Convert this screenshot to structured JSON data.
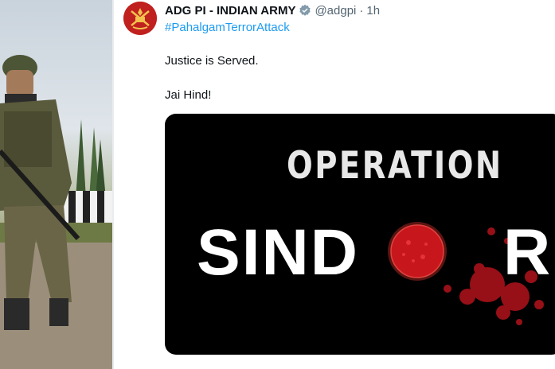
{
  "tweet": {
    "account_name": "ADG PI - INDIAN ARMY",
    "handle": "@adgpi",
    "separator": "·",
    "time": "1h",
    "hashtag": "#PahalgamTerrorAttack",
    "line1": "Justice is Served.",
    "line2": "Jai Hind!"
  },
  "media": {
    "title_top": "OPERATION",
    "title_main": "SIND",
    "title_end": "R"
  },
  "colors": {
    "hashtag_blue": "#1d9bf0",
    "verified_badge": "#829aab",
    "avatar_red": "#c0201e",
    "sindoor_red": "#d2151e"
  }
}
